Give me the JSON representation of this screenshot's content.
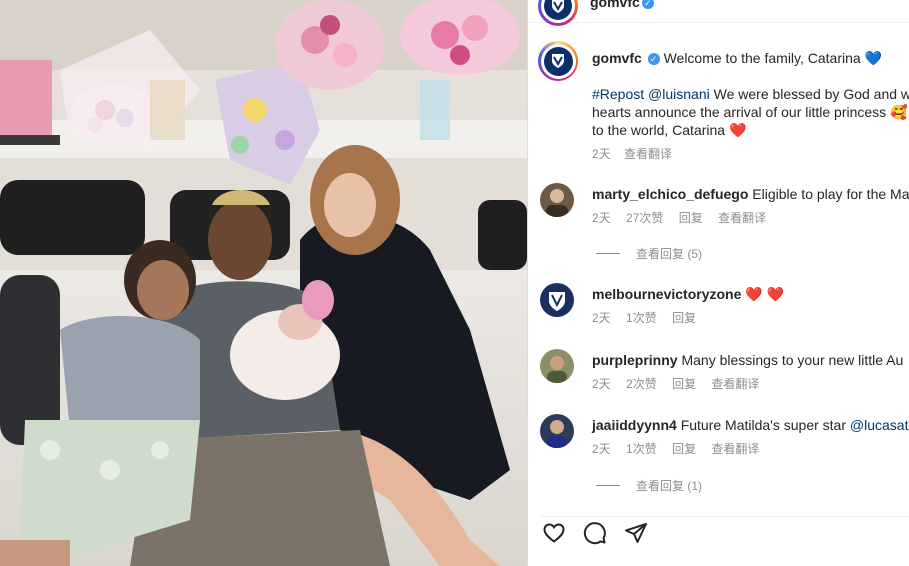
{
  "photo": {
    "alt_subject": "family-with-newborn-photo"
  },
  "post_header": {
    "username": "gomvfc"
  },
  "caption": {
    "username": "gomvfc",
    "text": "Welcome to the family, Catarina",
    "emoji": "💙",
    "line1_prefix": "#Repost ",
    "line1_mention": "@luisnani",
    "line1_text": " We were blessed by God and wi",
    "line2_text": "hearts announce the arrival of our little princess",
    "line2_emoji": "🥰",
    "line3_text": "to the world, Catarina",
    "line3_emoji": "❤️",
    "time": "2天",
    "translate": "查看翻译"
  },
  "comments": [
    {
      "username": "marty_elchico_defuego",
      "text": "Eligible to play for the Ma",
      "time": "2天",
      "likes": "27次赞",
      "reply": "回复",
      "translate": "查看翻译",
      "view_replies": "查看回复 (5)",
      "avatar_color": "#6d5a44"
    },
    {
      "username": "melbournevictoryzone",
      "text": "",
      "emoji": "❤️ ❤️",
      "time": "2天",
      "likes": "1次赞",
      "reply": "回复",
      "avatar_color": "#1b2f64"
    },
    {
      "username": "purpleprinny",
      "text": "Many blessings to your new little Au",
      "time": "2天",
      "likes": "2次赞",
      "reply": "回复",
      "translate": "查看翻译",
      "avatar_color": "#8a8f6a"
    },
    {
      "username": "jaaiiddyynn4",
      "text": "Future Matilda's super star ",
      "mention": "@lucasat",
      "time": "2天",
      "likes": "1次赞",
      "reply": "回复",
      "translate": "查看翻译",
      "view_replies": "查看回复 (1)",
      "avatar_color": "#2c3b5a"
    }
  ],
  "actions": {
    "like": "heart-icon",
    "comment": "comment-icon",
    "share": "share-icon"
  },
  "colors": {
    "link": "#00376b",
    "muted": "#8e8e8e",
    "verified": "#3897f0",
    "heart": "#e0242f",
    "club_navy": "#0b2f6b"
  }
}
